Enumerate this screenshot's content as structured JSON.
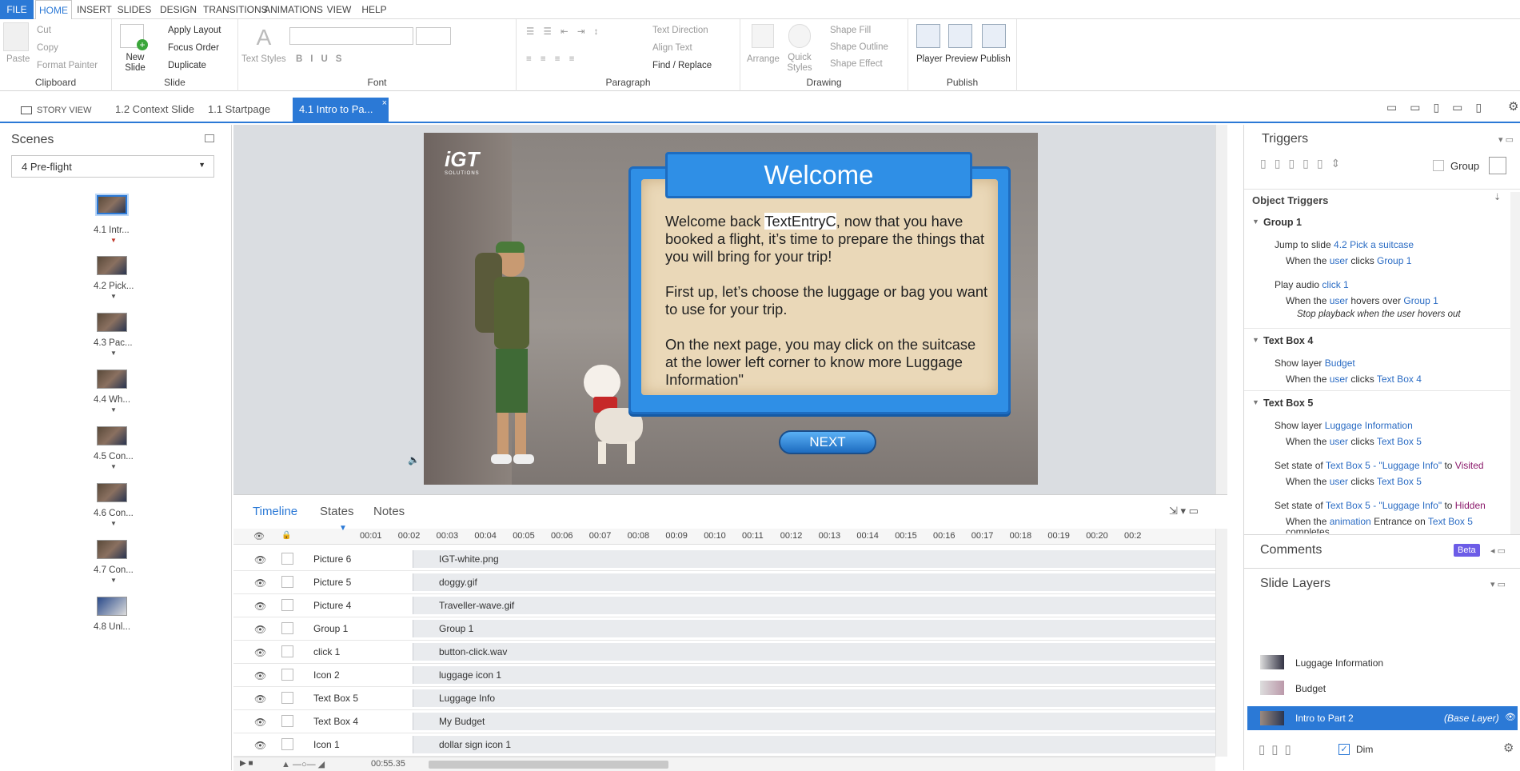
{
  "menu": {
    "tabs": [
      "FILE",
      "HOME",
      "INSERT",
      "SLIDES",
      "DESIGN",
      "TRANSITIONS",
      "ANIMATIONS",
      "VIEW",
      "HELP"
    ]
  },
  "ribbon": {
    "clipboard": {
      "paste": "Paste",
      "cut": "Cut",
      "copy": "Copy",
      "format_painter": "Format Painter",
      "label": "Clipboard"
    },
    "slide": {
      "new_slide": "New Slide",
      "apply_layout": "Apply Layout",
      "focus_order": "Focus Order",
      "duplicate": "Duplicate",
      "label": "Slide"
    },
    "font": {
      "text_styles": "Text Styles",
      "label": "Font"
    },
    "paragraph": {
      "text_direction": "Text Direction",
      "align_text": "Align Text",
      "find_replace": "Find / Replace",
      "label": "Paragraph"
    },
    "drawing": {
      "arrange": "Arrange",
      "quick_styles": "Quick Styles",
      "shape_fill": "Shape Fill",
      "shape_outline": "Shape Outline",
      "shape_effect": "Shape Effect",
      "label": "Drawing"
    },
    "publish": {
      "player": "Player",
      "preview": "Preview",
      "publish": "Publish",
      "label": "Publish"
    }
  },
  "doc_tabs": [
    "STORY VIEW",
    "1.2 Context Slide",
    "1.1 Startpage",
    "4.1 Intro to Pa..."
  ],
  "scenes": {
    "title": "Scenes",
    "selected": "4 Pre-flight",
    "slides": [
      "4.1 Intr...",
      "4.2 Pick...",
      "4.3 Pac...",
      "4.4 Wh...",
      "4.5 Con...",
      "4.6 Con...",
      "4.7 Con...",
      "4.8 Unl..."
    ]
  },
  "slide": {
    "logo": "iGT",
    "logo_sub": "SOLUTIONS",
    "title": "Welcome",
    "para1_pre": "Welcome back ",
    "para1_var": "TextEntryC",
    "para1_post": ", now that you have booked a flight, it’s time to prepare the things that you will bring for your trip!",
    "para2": "First up, let’s choose the luggage or bag you want to use for your trip.",
    "para3": "On the next page, you may click on the suitcase at the lower left corner to know more Luggage Information\"",
    "next": "NEXT"
  },
  "timeline": {
    "tabs": [
      "Timeline",
      "States",
      "Notes"
    ],
    "ticks": [
      "00:01",
      "00:02",
      "00:03",
      "00:04",
      "00:05",
      "00:06",
      "00:07",
      "00:08",
      "00:09",
      "00:10",
      "00:11",
      "00:12",
      "00:13",
      "00:14",
      "00:15",
      "00:16",
      "00:17",
      "00:18",
      "00:19",
      "00:20",
      "00:2"
    ],
    "rows": [
      {
        "name": "Picture 6",
        "item": "IGT-white.png"
      },
      {
        "name": "Picture 5",
        "item": "doggy.gif"
      },
      {
        "name": "Picture 4",
        "item": "Traveller-wave.gif"
      },
      {
        "name": "Group 1",
        "item": "Group 1"
      },
      {
        "name": "click 1",
        "item": "button-click.wav"
      },
      {
        "name": "Icon 2",
        "item": "luggage icon 1"
      },
      {
        "name": "Text Box 5",
        "item": "Luggage Info"
      },
      {
        "name": "Text Box 4",
        "item": "My Budget"
      },
      {
        "name": "Icon 1",
        "item": "dollar sign icon 1"
      }
    ],
    "duration": "00:55.35"
  },
  "triggers": {
    "title": "Triggers",
    "group_label": "Group",
    "object_triggers": "Object Triggers",
    "groups": [
      {
        "name": "Group 1",
        "items": [
          {
            "action": "Jump to slide ",
            "target": "4.2 Pick a suitcase",
            "when_pre": "When the ",
            "when_who": "user",
            "when_mid": " clicks ",
            "when_obj": "Group 1"
          },
          {
            "action": "Play audio ",
            "target": "click 1",
            "when_pre": "When the ",
            "when_who": "user",
            "when_mid": " hovers over ",
            "when_obj": "Group 1",
            "extra": "Stop playback when the user hovers out"
          }
        ]
      },
      {
        "name": "Text Box 4",
        "items": [
          {
            "action": "Show layer ",
            "target": "Budget",
            "when_pre": "When the ",
            "when_who": "user",
            "when_mid": " clicks ",
            "when_obj": "Text Box 4"
          }
        ]
      },
      {
        "name": "Text Box 5",
        "items": [
          {
            "action": "Show layer ",
            "target": "Luggage Information",
            "when_pre": "When the ",
            "when_who": "user",
            "when_mid": " clicks ",
            "when_obj": "Text Box 5"
          },
          {
            "action": "Set state of ",
            "target": "Text Box 5 - \"Luggage Info\"",
            "mid": " to ",
            "state": "Visited",
            "when_pre": "When the ",
            "when_who": "user",
            "when_mid": " clicks ",
            "when_obj": "Text Box 5"
          },
          {
            "action": "Set state of ",
            "target": "Text Box 5 - \"Luggage Info\"",
            "mid": " to ",
            "state": "Hidden",
            "when_pre": "When the ",
            "when_who": "animation",
            "when_mid": " Entrance on ",
            "when_obj": "Text Box 5",
            "extra2": "completes"
          }
        ]
      }
    ]
  },
  "comments": {
    "title": "Comments",
    "badge": "Beta"
  },
  "layers": {
    "title": "Slide Layers",
    "items": [
      "Luggage Information",
      "Budget"
    ],
    "base": "Intro to Part 2",
    "base_tag": "(Base Layer)",
    "dim": "Dim"
  },
  "colors": {
    "accent": "#2b79d6",
    "link": "#2b6cc4",
    "slide_blue": "#2f8fe6",
    "scroll_tan": "#ead8b8"
  }
}
